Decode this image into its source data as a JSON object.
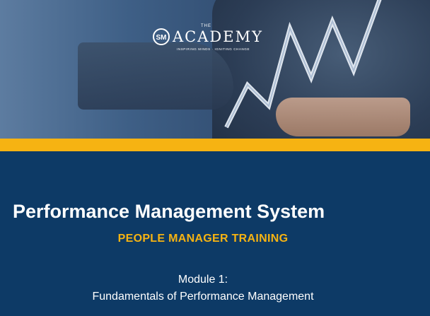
{
  "logo": {
    "badge": "SM",
    "the": "THE",
    "word": "ACADEMY",
    "tagline": "INSPIRING MINDS · IGNITING CHANGE"
  },
  "cover": {
    "title": "Performance Management System",
    "subtitle": "PEOPLE MANAGER TRAINING",
    "module_label": "Module 1:",
    "module_name": "Fundamentals of Performance Management"
  },
  "colors": {
    "navy": "#0d3a66",
    "gold": "#f6b312",
    "white": "#ffffff"
  }
}
